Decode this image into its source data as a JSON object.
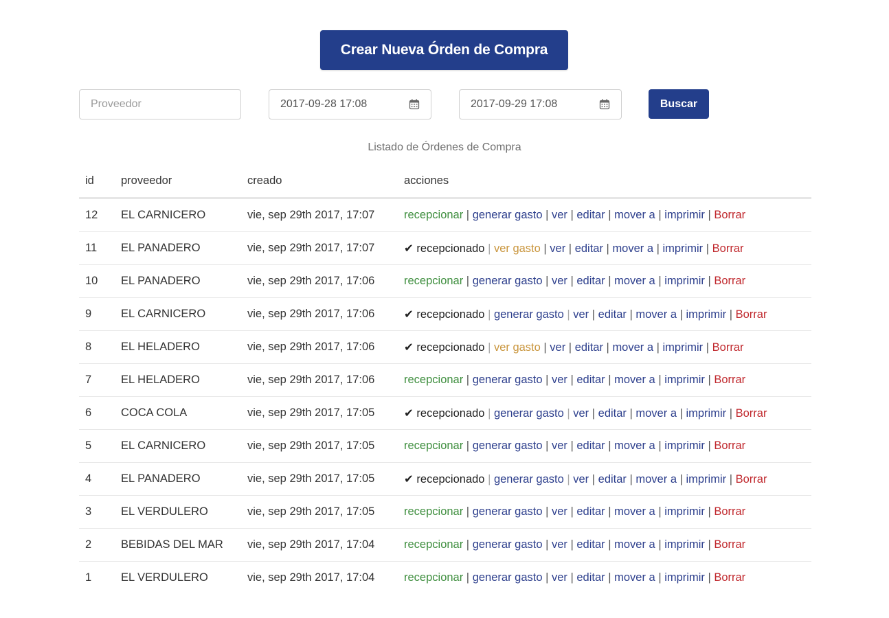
{
  "header": {
    "create_button": "Crear Nueva Órden de Compra"
  },
  "filters": {
    "supplier_placeholder": "Proveedor",
    "date_from": "2017-09-28 17:08",
    "date_to": "2017-09-29 17:08",
    "search_button": "Buscar"
  },
  "table": {
    "caption": "Listado de Órdenes de Compra",
    "columns": [
      "id",
      "proveedor",
      "creado",
      "acciones"
    ],
    "labels": {
      "receive": "recepcionar",
      "received": "✔ recepcionado",
      "generate_expense": "generar gasto",
      "view_expense": "ver gasto",
      "view": "ver",
      "edit": "editar",
      "move": "mover a",
      "print": "imprimir",
      "delete": "Borrar"
    },
    "rows": [
      {
        "id": "12",
        "supplier": "EL CARNICERO",
        "created": "vie, sep 29th 2017, 17:07",
        "received": false,
        "expense": false
      },
      {
        "id": "11",
        "supplier": "EL PANADERO",
        "created": "vie, sep 29th 2017, 17:07",
        "received": true,
        "expense": true
      },
      {
        "id": "10",
        "supplier": "EL PANADERO",
        "created": "vie, sep 29th 2017, 17:06",
        "received": false,
        "expense": false
      },
      {
        "id": "9",
        "supplier": "EL CARNICERO",
        "created": "vie, sep 29th 2017, 17:06",
        "received": true,
        "expense": false
      },
      {
        "id": "8",
        "supplier": "EL HELADERO",
        "created": "vie, sep 29th 2017, 17:06",
        "received": true,
        "expense": true
      },
      {
        "id": "7",
        "supplier": "EL HELADERO",
        "created": "vie, sep 29th 2017, 17:06",
        "received": false,
        "expense": false
      },
      {
        "id": "6",
        "supplier": "COCA COLA",
        "created": "vie, sep 29th 2017, 17:05",
        "received": true,
        "expense": false
      },
      {
        "id": "5",
        "supplier": "EL CARNICERO",
        "created": "vie, sep 29th 2017, 17:05",
        "received": false,
        "expense": false
      },
      {
        "id": "4",
        "supplier": "EL PANADERO",
        "created": "vie, sep 29th 2017, 17:05",
        "received": true,
        "expense": false
      },
      {
        "id": "3",
        "supplier": "EL VERDULERO",
        "created": "vie, sep 29th 2017, 17:05",
        "received": false,
        "expense": false
      },
      {
        "id": "2",
        "supplier": "BEBIDAS DEL MAR",
        "created": "vie, sep 29th 2017, 17:04",
        "received": false,
        "expense": false
      },
      {
        "id": "1",
        "supplier": "EL VERDULERO",
        "created": "vie, sep 29th 2017, 17:04",
        "received": false,
        "expense": false
      }
    ]
  }
}
